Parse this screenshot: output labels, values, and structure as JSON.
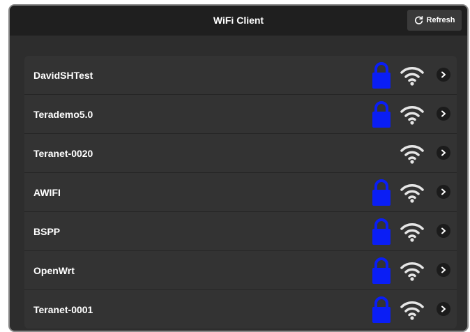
{
  "header": {
    "title": "WiFi Client",
    "refresh_label": "Refresh"
  },
  "networks": [
    {
      "ssid": "DavidSHTest",
      "secured": true
    },
    {
      "ssid": "Terademo5.0",
      "secured": true
    },
    {
      "ssid": "Teranet-0020",
      "secured": false
    },
    {
      "ssid": "AWIFI",
      "secured": true
    },
    {
      "ssid": "BSPP",
      "secured": true
    },
    {
      "ssid": "OpenWrt",
      "secured": true
    },
    {
      "ssid": "Teranet-0001",
      "secured": true
    }
  ],
  "icons": {
    "lock": "lock-icon",
    "signal": "wifi-signal-icon",
    "chevron": "chevron-right-icon",
    "refresh": "refresh-icon"
  },
  "colors": {
    "lock": "#0a1ef5",
    "signal": "#e6e6e6",
    "background": "#2d2d2d",
    "row": "#333333"
  }
}
